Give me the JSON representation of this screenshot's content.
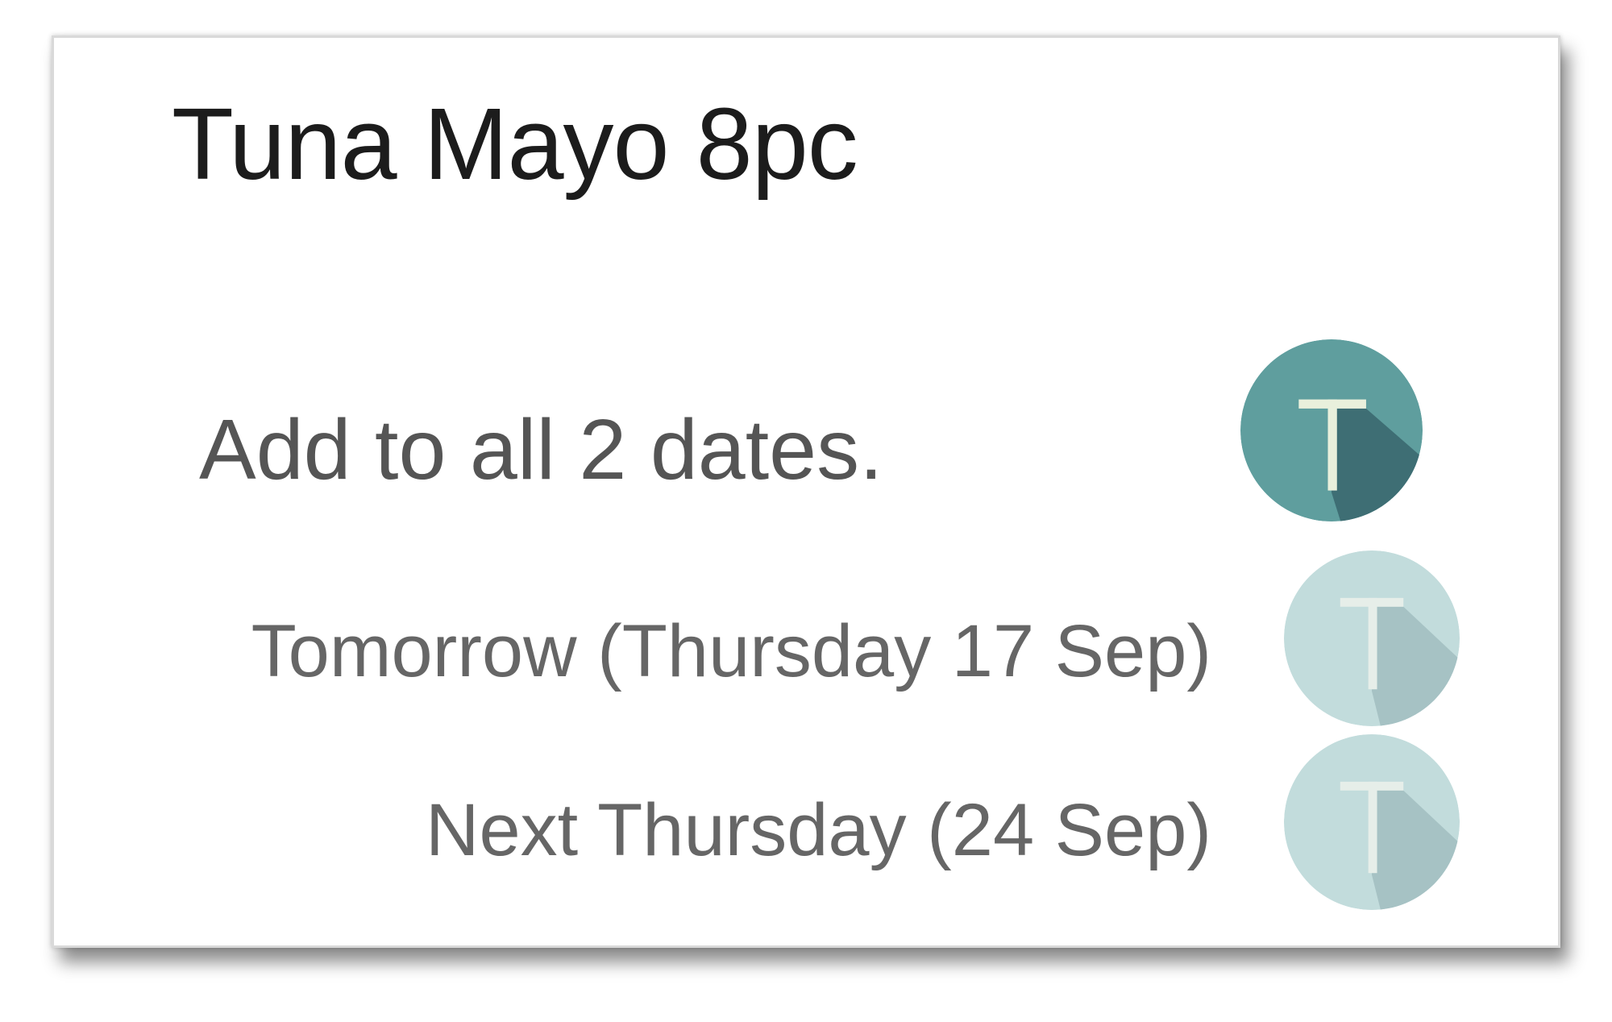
{
  "card": {
    "title": "Tuna Mayo 8pc",
    "add_all": {
      "label": "Add to all 2 dates.",
      "toggle_letter": "T",
      "toggle_state": "selected",
      "color": "#5f9e9e",
      "shade_color": "#3e6e74"
    },
    "dates": [
      {
        "label": "Tomorrow (Thursday 17 Sep)",
        "toggle_letter": "T",
        "toggle_state": "unselected",
        "color": "#c2dcdc",
        "shade_color": "#a6c2c4"
      },
      {
        "label": "Next Thursday (24 Sep)",
        "toggle_letter": "T",
        "toggle_state": "unselected",
        "color": "#c2dcdc",
        "shade_color": "#a6c2c4"
      }
    ]
  }
}
